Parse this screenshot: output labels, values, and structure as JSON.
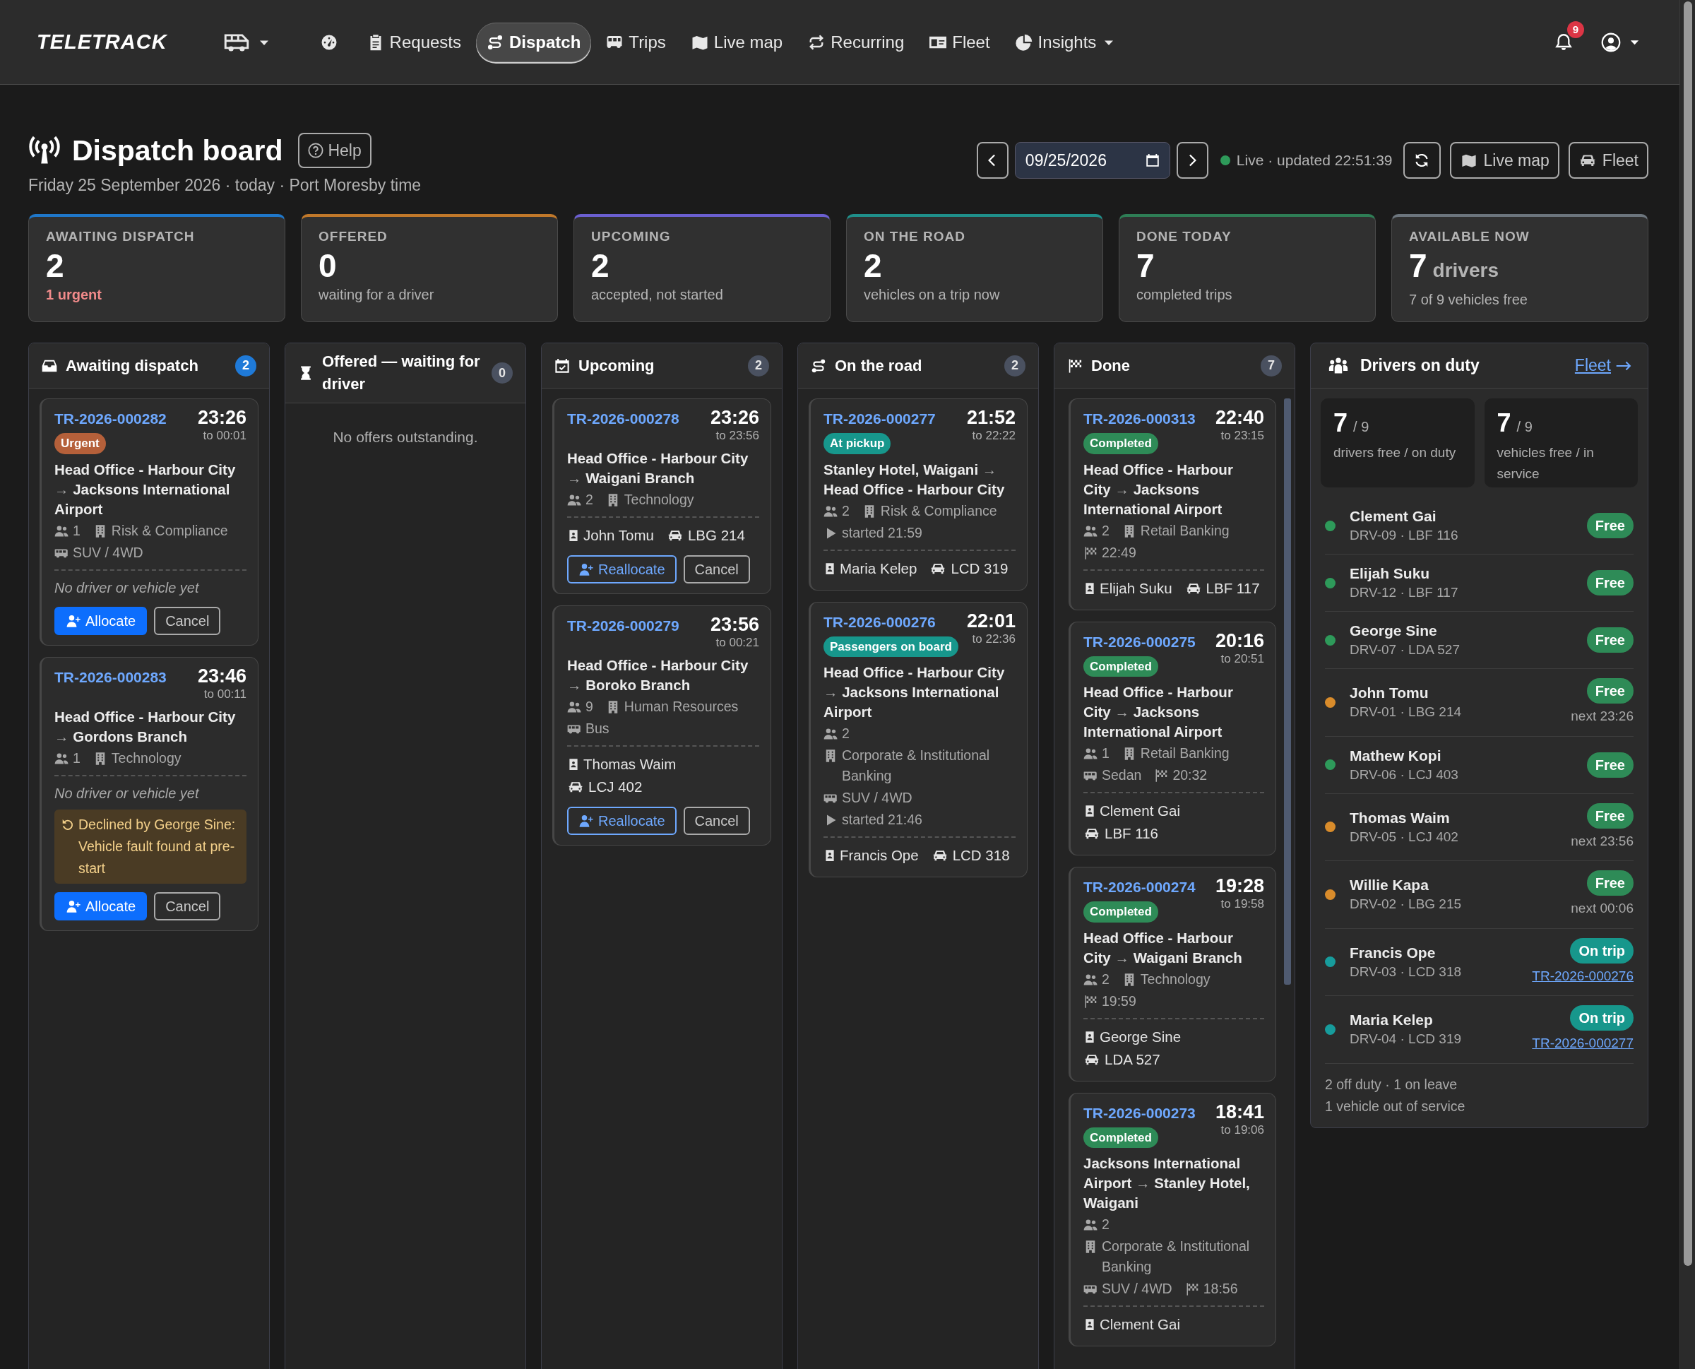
{
  "nav": {
    "logo": "TELETRACK",
    "items": [
      {
        "kind": "icon_menu",
        "selected": false
      },
      {
        "kind": "icon",
        "selected": false
      },
      {
        "kind": "link",
        "label": "Requests",
        "selected": false
      },
      {
        "kind": "link",
        "label": "Dispatch",
        "selected": true
      },
      {
        "kind": "link",
        "label": "Trips",
        "selected": false
      },
      {
        "kind": "link",
        "label": "Live map",
        "selected": false
      },
      {
        "kind": "link",
        "label": "Recurring",
        "selected": false
      },
      {
        "kind": "link",
        "label": "Fleet",
        "selected": false
      },
      {
        "kind": "menu",
        "label": "Insights",
        "selected": false
      }
    ],
    "notification_count": "9"
  },
  "page": {
    "title": "Dispatch board",
    "help": "Help",
    "subtitle": "Friday 25 September 2026 · today · Port Moresby time",
    "date": "09/25/2026",
    "live_status": "Live · updated 22:51:39",
    "buttons": [
      "Live map",
      "Fleet"
    ]
  },
  "stats": [
    {
      "label": "AWAITING DISPATCH",
      "value": "2",
      "sub": "1 urgent",
      "alert": true,
      "color": "#1f77c9"
    },
    {
      "label": "OFFERED",
      "value": "0",
      "sub": "waiting for a driver",
      "alert": false,
      "color": "#c0782a"
    },
    {
      "label": "UPCOMING",
      "value": "2",
      "sub": "accepted, not started",
      "alert": false,
      "color": "#6b5fd0"
    },
    {
      "label": "ON THE ROAD",
      "value": "2",
      "sub": "vehicles on a trip now",
      "alert": false,
      "color": "#1f8f8a"
    },
    {
      "label": "DONE TODAY",
      "value": "7",
      "sub": "completed trips",
      "alert": false,
      "color": "#2e7d55"
    },
    {
      "label": "AVAILABLE NOW",
      "value": "7",
      "unit": "drivers",
      "sub": "7 of 9 vehicles free",
      "alert": false,
      "color": "#6c757d"
    }
  ],
  "columns": [
    {
      "title": "Awaiting dispatch",
      "count": "2",
      "highlight": true,
      "cards": [
        {
          "id": "TR-2026-000282",
          "start": "23:26",
          "end": "to 00:01",
          "badge": {
            "label": "Urgent",
            "kind": "urgent"
          },
          "from": "Head Office - Harbour City",
          "arrow": "→",
          "to": "Jacksons International Airport",
          "meta": [
            [
              {
                "kind": "pax",
                "text": "1"
              },
              {
                "kind": "dept",
                "text": "Risk & Compliance"
              }
            ],
            [
              {
                "kind": "vehicle",
                "text": "SUV / 4WD"
              }
            ]
          ],
          "unassigned": "No driver or vehicle yet",
          "actions": [
            {
              "label": "Allocate",
              "kind": "primary"
            },
            {
              "label": "Cancel",
              "kind": "secondary"
            }
          ]
        },
        {
          "id": "TR-2026-000283",
          "start": "23:46",
          "end": "to 00:11",
          "from": "Head Office - Harbour City",
          "arrow": "→",
          "to": "Gordons Branch",
          "meta": [
            [
              {
                "kind": "pax",
                "text": "1"
              },
              {
                "kind": "dept",
                "text": "Technology"
              }
            ]
          ],
          "unassigned": "No driver or vehicle yet",
          "note": "Declined by George Sine: Vehicle fault found at pre-start",
          "actions": [
            {
              "label": "Allocate",
              "kind": "primary"
            },
            {
              "label": "Cancel",
              "kind": "secondary"
            }
          ]
        }
      ]
    },
    {
      "title": "Offered — waiting for driver",
      "count": "0",
      "highlight": false,
      "empty": "No offers outstanding."
    },
    {
      "title": "Upcoming",
      "count": "2",
      "highlight": false,
      "cards": [
        {
          "id": "TR-2026-000278",
          "start": "23:26",
          "end": "to 23:56",
          "from": "Head Office - Harbour City",
          "arrow": "→",
          "to": "Waigani Branch",
          "meta": [
            [
              {
                "kind": "pax",
                "text": "2"
              },
              {
                "kind": "dept",
                "text": "Technology"
              }
            ]
          ],
          "driver": "John Tomu",
          "vehicle": "LBG 214",
          "actions": [
            {
              "label": "Reallocate",
              "kind": "outline"
            },
            {
              "label": "Cancel",
              "kind": "secondary"
            }
          ]
        },
        {
          "id": "TR-2026-000279",
          "start": "23:56",
          "end": "to 00:21",
          "from": "Head Office - Harbour City",
          "arrow": "→",
          "to": "Boroko Branch",
          "meta": [
            [
              {
                "kind": "pax",
                "text": "9"
              },
              {
                "kind": "dept",
                "text": "Human Resources"
              }
            ],
            [
              {
                "kind": "vehicle",
                "text": "Bus"
              }
            ]
          ],
          "driver": "Thomas Waim",
          "vehicle": "LCJ 402",
          "actions": [
            {
              "label": "Reallocate",
              "kind": "outline"
            },
            {
              "label": "Cancel",
              "kind": "secondary"
            }
          ]
        }
      ]
    },
    {
      "title": "On the road",
      "count": "2",
      "highlight": false,
      "cards": [
        {
          "id": "TR-2026-000277",
          "start": "21:52",
          "end": "to 22:22",
          "badge": {
            "label": "At pickup",
            "kind": "active"
          },
          "from": "Stanley Hotel, Waigani",
          "arrow": "→",
          "to": "Head Office - Harbour City",
          "meta": [
            [
              {
                "kind": "pax",
                "text": "2"
              },
              {
                "kind": "dept",
                "text": "Risk & Compliance"
              }
            ],
            [
              {
                "kind": "started",
                "text": "started 21:59"
              }
            ]
          ],
          "driver": "Maria Kelep",
          "vehicle": "LCD 319"
        },
        {
          "id": "TR-2026-000276",
          "start": "22:01",
          "end": "to 22:36",
          "badge": {
            "label": "Passengers on board",
            "kind": "active"
          },
          "from": "Head Office - Harbour City",
          "arrow": "→",
          "to": "Jacksons International Airport",
          "meta": [
            [
              {
                "kind": "pax",
                "text": "2"
              }
            ],
            [
              {
                "kind": "dept",
                "text": "Corporate & Institutional Banking"
              }
            ],
            [
              {
                "kind": "vehicle",
                "text": "SUV / 4WD"
              }
            ],
            [
              {
                "kind": "started",
                "text": "started 21:46"
              }
            ]
          ],
          "driver": "Francis Ope",
          "vehicle": "LCD 318"
        }
      ]
    },
    {
      "title": "Done",
      "count": "7",
      "highlight": false,
      "scroll": true,
      "cards": [
        {
          "id": "TR-2026-000313",
          "start": "22:40",
          "end": "to 23:15",
          "badge": {
            "label": "Completed",
            "kind": "done"
          },
          "from": "Head Office - Harbour City",
          "arrow": "→",
          "to": "Jacksons International Airport",
          "meta": [
            [
              {
                "kind": "pax",
                "text": "2"
              },
              {
                "kind": "dept",
                "text": "Retail Banking"
              }
            ],
            [
              {
                "kind": "finished",
                "text": "22:49"
              }
            ]
          ],
          "driver": "Elijah Suku",
          "vehicle": "LBF 117"
        },
        {
          "id": "TR-2026-000275",
          "start": "20:16",
          "end": "to 20:51",
          "badge": {
            "label": "Completed",
            "kind": "done"
          },
          "from": "Head Office - Harbour City",
          "arrow": "→",
          "to": "Jacksons International Airport",
          "meta": [
            [
              {
                "kind": "pax",
                "text": "1"
              },
              {
                "kind": "dept",
                "text": "Retail Banking"
              }
            ],
            [
              {
                "kind": "vehicle",
                "text": "Sedan"
              },
              {
                "kind": "finished",
                "text": "20:32"
              }
            ]
          ],
          "driver": "Clement Gai",
          "vehicle": "LBF 116"
        },
        {
          "id": "TR-2026-000274",
          "start": "19:28",
          "end": "to 19:58",
          "badge": {
            "label": "Completed",
            "kind": "done"
          },
          "from": "Head Office - Harbour City",
          "arrow": "→",
          "to": "Waigani Branch",
          "meta": [
            [
              {
                "kind": "pax",
                "text": "2"
              },
              {
                "kind": "dept",
                "text": "Technology"
              }
            ],
            [
              {
                "kind": "finished",
                "text": "19:59"
              }
            ]
          ],
          "driver": "George Sine",
          "vehicle": "LDA 527"
        },
        {
          "id": "TR-2026-000273",
          "start": "18:41",
          "end": "to 19:06",
          "badge": {
            "label": "Completed",
            "kind": "done"
          },
          "from": "Jacksons International Airport",
          "arrow": "→",
          "to": "Stanley Hotel, Waigani",
          "meta": [
            [
              {
                "kind": "pax",
                "text": "2"
              }
            ],
            [
              {
                "kind": "dept",
                "text": "Corporate & Institutional Banking"
              }
            ],
            [
              {
                "kind": "vehicle",
                "text": "SUV / 4WD"
              },
              {
                "kind": "finished",
                "text": "18:56"
              }
            ]
          ],
          "driver": "Clement Gai"
        }
      ]
    }
  ],
  "drivers_panel": {
    "title": "Drivers on duty",
    "link": "Fleet",
    "tiles": [
      {
        "value": "7",
        "total": "/ 9",
        "label": "drivers free / on duty"
      },
      {
        "value": "7",
        "total": "/ 9",
        "label": "vehicles free / in service"
      }
    ],
    "drivers": [
      {
        "name": "Clement Gai",
        "sub": "DRV-09 · LBF 116",
        "color": "#2e9a5a",
        "status": {
          "label": "Free",
          "kind": "free"
        }
      },
      {
        "name": "Elijah Suku",
        "sub": "DRV-12 · LBF 117",
        "color": "#2e9a5a",
        "status": {
          "label": "Free",
          "kind": "free"
        }
      },
      {
        "name": "George Sine",
        "sub": "DRV-07 · LDA 527",
        "color": "#2e9a5a",
        "status": {
          "label": "Free",
          "kind": "free"
        }
      },
      {
        "name": "John Tomu",
        "sub": "DRV-01 · LBG 214",
        "color": "#d98c2b",
        "status": {
          "label": "Free",
          "kind": "free"
        },
        "next": "next 23:26"
      },
      {
        "name": "Mathew Kopi",
        "sub": "DRV-06 · LCJ 403",
        "color": "#2e9a5a",
        "status": {
          "label": "Free",
          "kind": "free"
        }
      },
      {
        "name": "Thomas Waim",
        "sub": "DRV-05 · LCJ 402",
        "color": "#d98c2b",
        "status": {
          "label": "Free",
          "kind": "free"
        },
        "next": "next 23:56"
      },
      {
        "name": "Willie Kapa",
        "sub": "DRV-02 · LBG 215",
        "color": "#d98c2b",
        "status": {
          "label": "Free",
          "kind": "free"
        },
        "next": "next 00:06"
      },
      {
        "name": "Francis Ope",
        "sub": "DRV-03 · LCD 318",
        "color": "#179c9c",
        "status": {
          "label": "On trip",
          "kind": "trip"
        },
        "trip": "TR-2026-000276"
      },
      {
        "name": "Maria Kelep",
        "sub": "DRV-04 · LCD 319",
        "color": "#179c9c",
        "status": {
          "label": "On trip",
          "kind": "trip"
        },
        "trip": "TR-2026-000277"
      }
    ],
    "footer": [
      "2 off duty · 1 on leave",
      "1 vehicle out of service"
    ]
  }
}
